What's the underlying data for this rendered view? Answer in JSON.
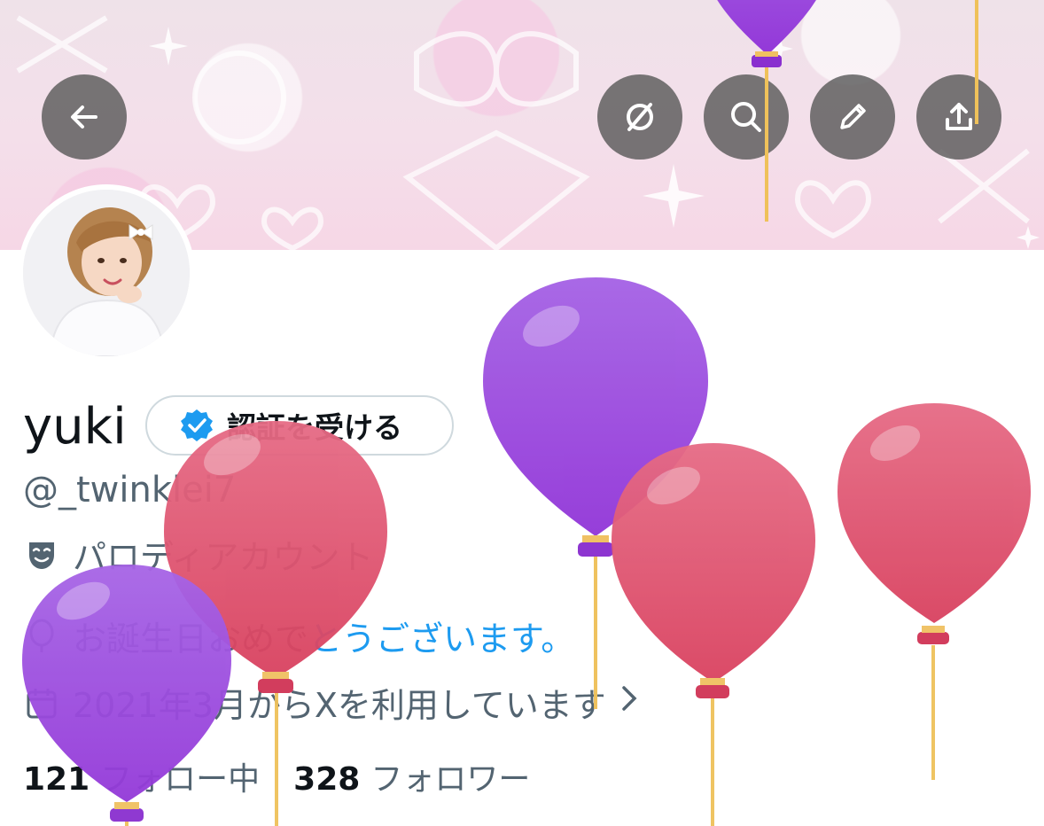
{
  "profile": {
    "display_name": "yuki",
    "verify_button_label": "認証を受ける",
    "handle": "@_twinklei7",
    "parody_label": "パロディアカウント",
    "bio_prefix": "お誕生日おめで",
    "bio_link": "とうございます。",
    "joined_text": "2021年3月からXを利用しています",
    "following_count": "121",
    "following_label": "フォロー中",
    "followers_count": "328",
    "followers_label": "フォロワー"
  },
  "toolbar": {
    "back_icon": "arrow-left-icon",
    "grok_icon": "grok-slash-icon",
    "search_icon": "search-icon",
    "edit_icon": "pencil-icon",
    "share_icon": "share-icon"
  },
  "colors": {
    "accent": "#1d9bf0",
    "balloon_purple": "#a04ee0",
    "balloon_pink": "#e35d7c",
    "muted_text": "#536471"
  }
}
